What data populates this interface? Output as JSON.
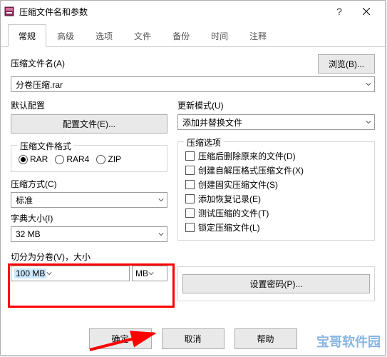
{
  "window": {
    "title": "压缩文件名和参数"
  },
  "tabs": [
    {
      "label": "常规"
    },
    {
      "label": "高级"
    },
    {
      "label": "选项"
    },
    {
      "label": "文件"
    },
    {
      "label": "备份"
    },
    {
      "label": "时间"
    },
    {
      "label": "注释"
    }
  ],
  "archive_name": {
    "label": "压缩文件名(A)",
    "browse": "浏览(B)...",
    "value": "分卷压缩.rar"
  },
  "default_profile": {
    "label": "默认配置",
    "button": "配置文件(E)..."
  },
  "update_mode": {
    "label": "更新模式(U)",
    "value": "添加并替换文件"
  },
  "format": {
    "title": "压缩文件格式",
    "options": [
      "RAR",
      "RAR4",
      "ZIP"
    ],
    "selected": "RAR"
  },
  "compress_options": {
    "title": "压缩选项",
    "items": [
      "压缩后删除原来的文件(D)",
      "创建自解压格式压缩文件(X)",
      "创建固实压缩文件(S)",
      "添加恢复记录(E)",
      "测试压缩的文件(T)",
      "锁定压缩文件(L)"
    ]
  },
  "method": {
    "label": "压缩方式(C)",
    "value": "标准"
  },
  "dict": {
    "label": "字典大小(I)",
    "value": "32 MB"
  },
  "split": {
    "label": "切分为分卷(V)，大小",
    "value": "100 MB",
    "unit": "MB"
  },
  "set_password": "设置密码(P)...",
  "footer": {
    "ok": "确定",
    "cancel": "取消",
    "help": "帮助"
  },
  "watermark": "宝哥软件园"
}
